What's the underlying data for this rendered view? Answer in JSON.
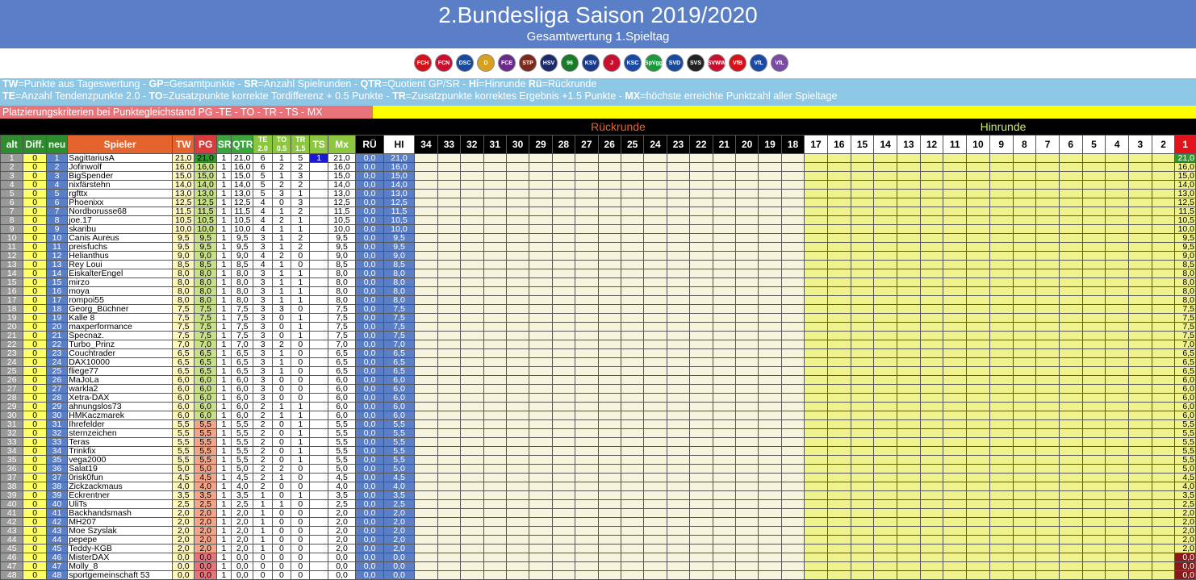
{
  "title": "2.Bundesliga Saison 2019/2020",
  "subtitle": "Gesamtwertung 1.Spieltag",
  "logos": [
    {
      "name": "fch-logo",
      "color": "#d4121a",
      "txt": "FCH"
    },
    {
      "name": "fcn-logo",
      "color": "#c8102e",
      "txt": "FCN"
    },
    {
      "name": "arminia-logo",
      "color": "#1a4a9c",
      "txt": "DSC"
    },
    {
      "name": "dynamo-logo",
      "color": "#d8a01c",
      "txt": "D"
    },
    {
      "name": "aue-logo",
      "color": "#6a2a8a",
      "txt": "FCE"
    },
    {
      "name": "stpauli-logo",
      "color": "#7a2a1a",
      "txt": "STP"
    },
    {
      "name": "hsv-logo",
      "color": "#1a2a6a",
      "txt": "HSV"
    },
    {
      "name": "hannover-logo",
      "color": "#1a7a2a",
      "txt": "96"
    },
    {
      "name": "kiel-logo",
      "color": "#1a3a8a",
      "txt": "KSV"
    },
    {
      "name": "regensburg-logo",
      "color": "#c8102e",
      "txt": "J"
    },
    {
      "name": "ksc-logo",
      "color": "#1a4aa6",
      "txt": "KSC"
    },
    {
      "name": "fuerth-logo",
      "color": "#1a9a3a",
      "txt": "SpVgg"
    },
    {
      "name": "darmstadt-logo",
      "color": "#1a4a9c",
      "txt": "SVD"
    },
    {
      "name": "sandhausen-logo",
      "color": "#222222",
      "txt": "SVS"
    },
    {
      "name": "wiesbaden-logo",
      "color": "#c8102e",
      "txt": "SVWW"
    },
    {
      "name": "stuttgart-logo",
      "color": "#d4121a",
      "txt": "VfB"
    },
    {
      "name": "bochum-logo",
      "color": "#1a4aa6",
      "txt": "VfL"
    },
    {
      "name": "osnabrueck-logo",
      "color": "#7a4aa6",
      "txt": "VfL"
    }
  ],
  "legend": {
    "line1": [
      {
        "b": "TW",
        "t": "=Punkte aus Tageswertung - "
      },
      {
        "b": "GP",
        "t": "=Gesamtpunkte - "
      },
      {
        "b": "SR",
        "t": "=Anzahl Spielrunden - "
      },
      {
        "b": "QTR",
        "t": "=Quotient GP/SR - "
      },
      {
        "b": "Hi",
        "t": "=Hinrunde "
      },
      {
        "b": "Rü",
        "t": "=Rückrunde"
      }
    ],
    "line2": [
      {
        "b": "TE",
        "t": "=Anzahl Tendenzpunkte 2.0 - "
      },
      {
        "b": "TO",
        "t": "=Zusatzpunkte korrekte Tordifferenz + 0.5 Punkte - "
      },
      {
        "b": "TR",
        "t": "=Zusatzpunkte korrektes Ergebnis +1.5 Punkte - "
      },
      {
        "b": "MX",
        "t": "=höchste erreichte Punktzahl aller Spieltage"
      }
    ]
  },
  "criteria": "Platzierungskriterien bei Punktegleichstand  PG  -TE - TO - TR - TS - MX",
  "rueckrunde_label": "Rückrunde",
  "hinrunde_label": "Hinrunde",
  "headers": {
    "alt": "alt",
    "diff": "Diff.",
    "neu": "neu",
    "spieler": "Spieler",
    "tw": "TW",
    "pg": "PG",
    "sr": "SR",
    "qtr": "QTR",
    "te": "TE",
    "te_sub": "2.0",
    "to": "TO",
    "to_sub": "0.5",
    "tr": "TR",
    "tr_sub": "1.5",
    "ts": "TS",
    "mx": "Mx",
    "ru": "RÜ",
    "hi": "HI"
  },
  "rueck_rounds": [
    "34",
    "33",
    "32",
    "31",
    "30",
    "29",
    "28",
    "27",
    "26",
    "25",
    "24",
    "23",
    "22",
    "21",
    "20",
    "19",
    "18"
  ],
  "hin_rounds": [
    "17",
    "16",
    "15",
    "14",
    "13",
    "12",
    "11",
    "10",
    "9",
    "8",
    "7",
    "6",
    "5",
    "4",
    "3",
    "2",
    "1"
  ],
  "rows": [
    [
      "1",
      "0",
      "1",
      "SagittariusA",
      "21,0",
      "21,0",
      "1",
      "21,0",
      "6",
      "1",
      "5",
      "1",
      "21,0",
      "0,0",
      "21,0"
    ],
    [
      "2",
      "0",
      "2",
      "Jofinwolf",
      "16,0",
      "16,0",
      "1",
      "16,0",
      "6",
      "2",
      "2",
      "",
      "16,0",
      "0,0",
      "16,0"
    ],
    [
      "3",
      "0",
      "3",
      "BigSpender",
      "15,0",
      "15,0",
      "1",
      "15,0",
      "5",
      "1",
      "3",
      "",
      "15,0",
      "0,0",
      "15,0"
    ],
    [
      "4",
      "0",
      "4",
      "nixfärstehn",
      "14,0",
      "14,0",
      "1",
      "14,0",
      "5",
      "2",
      "2",
      "",
      "14,0",
      "0,0",
      "14,0"
    ],
    [
      "5",
      "0",
      "5",
      "rgfttx",
      "13,0",
      "13,0",
      "1",
      "13,0",
      "5",
      "3",
      "1",
      "",
      "13,0",
      "0,0",
      "13,0"
    ],
    [
      "6",
      "0",
      "6",
      "Phoenixx",
      "12,5",
      "12,5",
      "1",
      "12,5",
      "4",
      "0",
      "3",
      "",
      "12,5",
      "0,0",
      "12,5"
    ],
    [
      "7",
      "0",
      "7",
      "Nordborusse68",
      "11,5",
      "11,5",
      "1",
      "11,5",
      "4",
      "1",
      "2",
      "",
      "11,5",
      "0,0",
      "11,5"
    ],
    [
      "8",
      "0",
      "8",
      "joe.17",
      "10,5",
      "10,5",
      "1",
      "10,5",
      "4",
      "2",
      "1",
      "",
      "10,5",
      "0,0",
      "10,5"
    ],
    [
      "9",
      "0",
      "9",
      "skaribu",
      "10,0",
      "10,0",
      "1",
      "10,0",
      "4",
      "1",
      "1",
      "",
      "10,0",
      "0,0",
      "10,0"
    ],
    [
      "10",
      "0",
      "10",
      "Canis Aureus",
      "9,5",
      "9,5",
      "1",
      "9,5",
      "3",
      "1",
      "2",
      "",
      "9,5",
      "0,0",
      "9,5"
    ],
    [
      "11",
      "0",
      "11",
      "preisfuchs",
      "9,5",
      "9,5",
      "1",
      "9,5",
      "3",
      "1",
      "2",
      "",
      "9,5",
      "0,0",
      "9,5"
    ],
    [
      "12",
      "0",
      "12",
      "Helianthus",
      "9,0",
      "9,0",
      "1",
      "9,0",
      "4",
      "2",
      "0",
      "",
      "9,0",
      "0,0",
      "9,0"
    ],
    [
      "13",
      "0",
      "13",
      "Rey Loui",
      "8,5",
      "8,5",
      "1",
      "8,5",
      "4",
      "1",
      "0",
      "",
      "8,5",
      "0,0",
      "8,5"
    ],
    [
      "14",
      "0",
      "14",
      "EiskalterEngel",
      "8,0",
      "8,0",
      "1",
      "8,0",
      "3",
      "1",
      "1",
      "",
      "8,0",
      "0,0",
      "8,0"
    ],
    [
      "15",
      "0",
      "15",
      "mirzo",
      "8,0",
      "8,0",
      "1",
      "8,0",
      "3",
      "1",
      "1",
      "",
      "8,0",
      "0,0",
      "8,0"
    ],
    [
      "16",
      "0",
      "16",
      "moya",
      "8,0",
      "8,0",
      "1",
      "8,0",
      "3",
      "1",
      "1",
      "",
      "8,0",
      "0,0",
      "8,0"
    ],
    [
      "17",
      "0",
      "17",
      "rompoi55",
      "8,0",
      "8,0",
      "1",
      "8,0",
      "3",
      "1",
      "1",
      "",
      "8,0",
      "0,0",
      "8,0"
    ],
    [
      "18",
      "0",
      "18",
      "Georg_Büchner",
      "7,5",
      "7,5",
      "1",
      "7,5",
      "3",
      "3",
      "0",
      "",
      "7,5",
      "0,0",
      "7,5"
    ],
    [
      "19",
      "0",
      "19",
      "Kalle 8",
      "7,5",
      "7,5",
      "1",
      "7,5",
      "3",
      "0",
      "1",
      "",
      "7,5",
      "0,0",
      "7,5"
    ],
    [
      "20",
      "0",
      "20",
      "maxperformance",
      "7,5",
      "7,5",
      "1",
      "7,5",
      "3",
      "0",
      "1",
      "",
      "7,5",
      "0,0",
      "7,5"
    ],
    [
      "21",
      "0",
      "21",
      "Specnaz.",
      "7,5",
      "7,5",
      "1",
      "7,5",
      "3",
      "0",
      "1",
      "",
      "7,5",
      "0,0",
      "7,5"
    ],
    [
      "22",
      "0",
      "22",
      "Turbo_Prinz",
      "7,0",
      "7,0",
      "1",
      "7,0",
      "3",
      "2",
      "0",
      "",
      "7,0",
      "0,0",
      "7,0"
    ],
    [
      "23",
      "0",
      "23",
      "Couchtrader",
      "6,5",
      "6,5",
      "1",
      "6,5",
      "3",
      "1",
      "0",
      "",
      "6,5",
      "0,0",
      "6,5"
    ],
    [
      "24",
      "0",
      "24",
      "DAX10000",
      "6,5",
      "6,5",
      "1",
      "6,5",
      "3",
      "1",
      "0",
      "",
      "6,5",
      "0,0",
      "6,5"
    ],
    [
      "25",
      "0",
      "25",
      "fliege77",
      "6,5",
      "6,5",
      "1",
      "6,5",
      "3",
      "1",
      "0",
      "",
      "6,5",
      "0,0",
      "6,5"
    ],
    [
      "26",
      "0",
      "26",
      "MaJoLa",
      "6,0",
      "6,0",
      "1",
      "6,0",
      "3",
      "0",
      "0",
      "",
      "6,0",
      "0,0",
      "6,0"
    ],
    [
      "27",
      "0",
      "27",
      "warkla2",
      "6,0",
      "6,0",
      "1",
      "6,0",
      "3",
      "0",
      "0",
      "",
      "6,0",
      "0,0",
      "6,0"
    ],
    [
      "28",
      "0",
      "28",
      "Xetra-DAX",
      "6,0",
      "6,0",
      "1",
      "6,0",
      "3",
      "0",
      "0",
      "",
      "6,0",
      "0,0",
      "6,0"
    ],
    [
      "29",
      "0",
      "29",
      "ahnungslos73",
      "6,0",
      "6,0",
      "1",
      "6,0",
      "2",
      "1",
      "1",
      "",
      "6,0",
      "0,0",
      "6,0"
    ],
    [
      "30",
      "0",
      "30",
      "HMKaczmarek",
      "6,0",
      "6,0",
      "1",
      "6,0",
      "2",
      "1",
      "1",
      "",
      "6,0",
      "0,0",
      "6,0"
    ],
    [
      "31",
      "0",
      "31",
      "Ihrefelder",
      "5,5",
      "5,5",
      "1",
      "5,5",
      "2",
      "0",
      "1",
      "",
      "5,5",
      "0,0",
      "5,5"
    ],
    [
      "32",
      "0",
      "32",
      "sternzeichen",
      "5,5",
      "5,5",
      "1",
      "5,5",
      "2",
      "0",
      "1",
      "",
      "5,5",
      "0,0",
      "5,5"
    ],
    [
      "33",
      "0",
      "33",
      "Teras",
      "5,5",
      "5,5",
      "1",
      "5,5",
      "2",
      "0",
      "1",
      "",
      "5,5",
      "0,0",
      "5,5"
    ],
    [
      "34",
      "0",
      "34",
      "Trinkfix",
      "5,5",
      "5,5",
      "1",
      "5,5",
      "2",
      "0",
      "1",
      "",
      "5,5",
      "0,0",
      "5,5"
    ],
    [
      "35",
      "0",
      "35",
      "vega2000",
      "5,5",
      "5,5",
      "1",
      "5,5",
      "2",
      "0",
      "1",
      "",
      "5,5",
      "0,0",
      "5,5"
    ],
    [
      "36",
      "0",
      "36",
      "Salat19",
      "5,0",
      "5,0",
      "1",
      "5,0",
      "2",
      "2",
      "0",
      "",
      "5,0",
      "0,0",
      "5,0"
    ],
    [
      "37",
      "0",
      "37",
      "0risk0fun",
      "4,5",
      "4,5",
      "1",
      "4,5",
      "2",
      "1",
      "0",
      "",
      "4,5",
      "0,0",
      "4,5"
    ],
    [
      "38",
      "0",
      "38",
      "Zickzackmaus",
      "4,0",
      "4,0",
      "1",
      "4,0",
      "2",
      "0",
      "0",
      "",
      "4,0",
      "0,0",
      "4,0"
    ],
    [
      "39",
      "0",
      "39",
      "Eckrentner",
      "3,5",
      "3,5",
      "1",
      "3,5",
      "1",
      "0",
      "1",
      "",
      "3,5",
      "0,0",
      "3,5"
    ],
    [
      "40",
      "0",
      "40",
      "UliTs",
      "2,5",
      "2,5",
      "1",
      "2,5",
      "1",
      "1",
      "0",
      "",
      "2,5",
      "0,0",
      "2,5"
    ],
    [
      "41",
      "0",
      "41",
      "Backhandsmash",
      "2,0",
      "2,0",
      "1",
      "2,0",
      "1",
      "0",
      "0",
      "",
      "2,0",
      "0,0",
      "2,0"
    ],
    [
      "42",
      "0",
      "42",
      "MH207",
      "2,0",
      "2,0",
      "1",
      "2,0",
      "1",
      "0",
      "0",
      "",
      "2,0",
      "0,0",
      "2,0"
    ],
    [
      "43",
      "0",
      "43",
      "Moe Szyslak",
      "2,0",
      "2,0",
      "1",
      "2,0",
      "1",
      "0",
      "0",
      "",
      "2,0",
      "0,0",
      "2,0"
    ],
    [
      "44",
      "0",
      "44",
      "pepepe",
      "2,0",
      "2,0",
      "1",
      "2,0",
      "1",
      "0",
      "0",
      "",
      "2,0",
      "0,0",
      "2,0"
    ],
    [
      "45",
      "0",
      "45",
      "Teddy-KGB",
      "2,0",
      "2,0",
      "1",
      "2,0",
      "1",
      "0",
      "0",
      "",
      "2,0",
      "0,0",
      "2,0"
    ],
    [
      "46",
      "0",
      "46",
      "MisterDAX",
      "0,0",
      "0,0",
      "1",
      "0,0",
      "0",
      "0",
      "0",
      "",
      "0,0",
      "0,0",
      "0,0"
    ],
    [
      "47",
      "0",
      "47",
      "Molly_8",
      "0,0",
      "0,0",
      "1",
      "0,0",
      "0",
      "0",
      "0",
      "",
      "0,0",
      "0,0",
      "0,0"
    ],
    [
      "48",
      "0",
      "48",
      "sportgemeinschaft 53",
      "0,0",
      "0,0",
      "1",
      "0,0",
      "0",
      "0",
      "0",
      "",
      "0,0",
      "0,0",
      "0,0"
    ]
  ],
  "colors": {
    "pg_high": "#2e9a2e",
    "pg_mid": "#c8e08a",
    "pg_low": "#f3a58a",
    "pg_zero": "#e8737a",
    "one_high": "#2e9a2e",
    "one_zero": "#8a1a1a"
  }
}
